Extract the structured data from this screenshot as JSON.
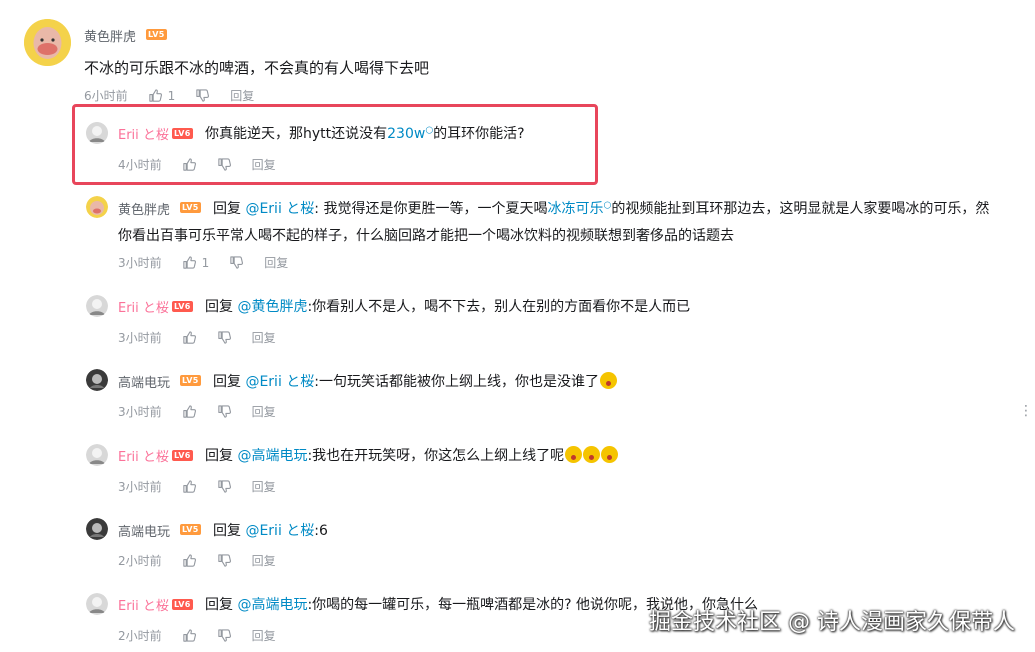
{
  "root": {
    "user": "黄色胖虎",
    "level": "LV5",
    "text": "不冰的可乐跟不冰的啤酒，不会真的有人喝得下去吧",
    "time": "6小时前",
    "likes": "1",
    "reply_label": "回复"
  },
  "replies": [
    {
      "user": "Erii と桜",
      "level": "LV6",
      "text_a": "你真能逆天，那hytt还说没有",
      "link": "230w",
      "text_b": "的耳环你能活?",
      "time": "4小时前",
      "reply_label": "回复"
    },
    {
      "user": "黄色胖虎",
      "level": "LV5",
      "prefix": "回复",
      "mention": "@Erii と桜",
      "text_a": ": 我觉得还是你更胜一等，一个夏天喝",
      "link": "冰冻可乐",
      "text_b": "的视频能扯到耳环那边去，这明显就是人家要喝冰的可乐，然",
      "text_line2": "你看出百事可乐平常人喝不起的样子，什么脑回路才能把一个喝冰饮料的视频联想到奢侈品的话题去",
      "time": "3小时前",
      "likes": "1",
      "reply_label": "回复"
    },
    {
      "user": "Erii と桜",
      "level": "LV6",
      "prefix": "回复",
      "mention": "@黄色胖虎",
      "text": ":你看别人不是人，喝不下去，别人在别的方面看你不是人而已",
      "time": "3小时前",
      "reply_label": "回复"
    },
    {
      "user": "高端电玩",
      "level": "LV5",
      "prefix": "回复",
      "mention": "@Erii と桜",
      "text": ":一句玩笑话都能被你上纲上线，你也是没谁了",
      "time": "3小时前",
      "reply_label": "回复"
    },
    {
      "user": "Erii と桜",
      "level": "LV6",
      "prefix": "回复",
      "mention": "@高端电玩",
      "text": ":我也在开玩笑呀，你这怎么上纲上线了呢",
      "time": "3小时前",
      "reply_label": "回复"
    },
    {
      "user": "高端电玩",
      "level": "LV5",
      "prefix": "回复",
      "mention": "@Erii と桜",
      "text": ":6",
      "time": "2小时前",
      "reply_label": "回复"
    },
    {
      "user": "Erii と桜",
      "level": "LV6",
      "prefix": "回复",
      "mention": "@高端电玩",
      "text": ":你喝的每一罐可乐，每一瓶啤酒都是冰的? 他说你呢，我说他，你急什么",
      "time": "2小时前",
      "reply_label": "回复"
    }
  ],
  "watermark": "掘金技术社区 @ 诗人漫画家久保带人",
  "icons": [
    "like-icon",
    "dislike-icon",
    "more-icon"
  ],
  "colors": {
    "link": "#008ac5",
    "pink_name": "#fb7299",
    "highlight": "#e8465b",
    "meta": "#9499a0"
  }
}
